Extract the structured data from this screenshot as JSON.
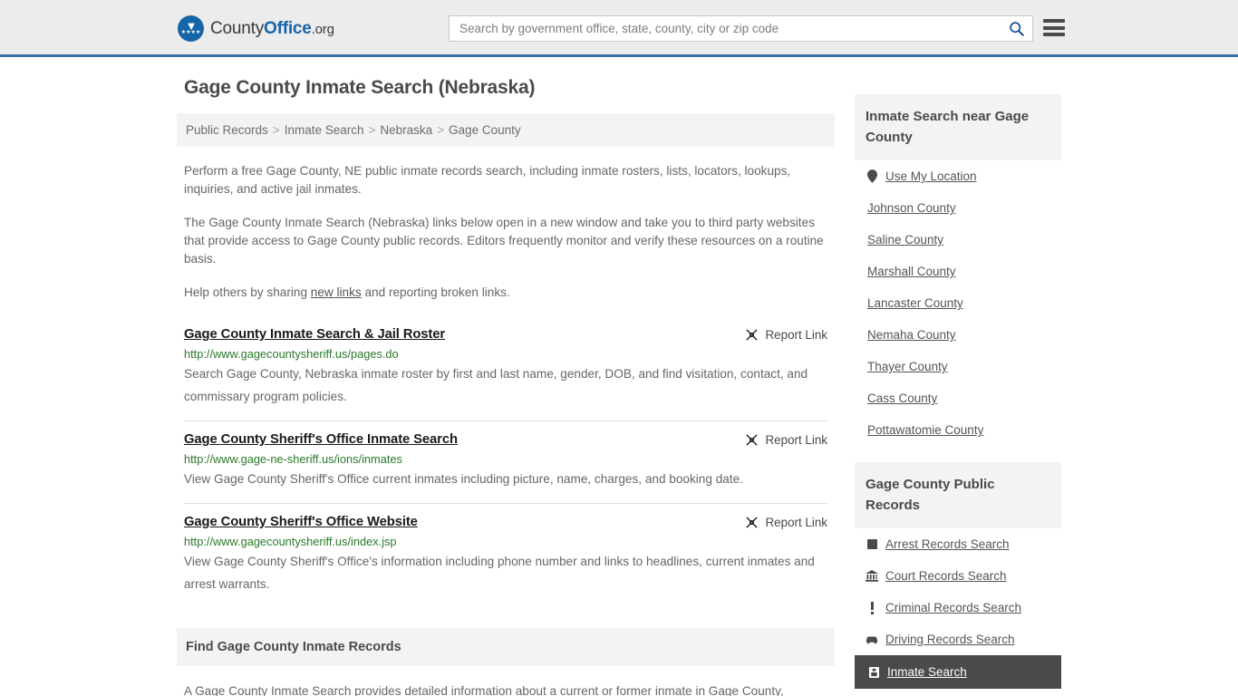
{
  "header": {
    "logo": {
      "part1": "County",
      "part2": "Office",
      "part3": ".org",
      "icon": "eagle-seal-icon",
      "eagle_glyph": "▼",
      "stars_glyph": "★★★★"
    },
    "search": {
      "placeholder": "Search by government office, state, county, city or zip code",
      "value": "",
      "icon": "search-icon"
    },
    "menu": {
      "icon": "hamburger-menu-icon",
      "label": "Menu"
    },
    "accent_color": "#3a6ea5",
    "background_color": "#ececec"
  },
  "page": {
    "title": "Gage County Inmate Search (Nebraska)"
  },
  "breadcrumb": {
    "items": [
      {
        "label": "Public Records"
      },
      {
        "label": "Inmate Search"
      },
      {
        "label": "Nebraska"
      },
      {
        "label": "Gage County"
      }
    ],
    "separator": ">"
  },
  "intro": {
    "p1": "Perform a free Gage County, NE public inmate records search, including inmate rosters, lists, locators, lookups, inquiries, and active jail inmates.",
    "p2": "The Gage County Inmate Search (Nebraska) links below open in a new window and take you to third party websites that provide access to Gage County public records. Editors frequently monitor and verify these resources on a routine basis.",
    "p3_before": "Help others by sharing ",
    "p3_link": "new links",
    "p3_after": " and reporting broken links."
  },
  "results": {
    "report_label": "Report Link",
    "report_icon": "broken-link-icon",
    "items": [
      {
        "title": "Gage County Inmate Search & Jail Roster",
        "url": "http://www.gagecountysheriff.us/pages.do",
        "description": "Search Gage County, Nebraska inmate roster by first and last name, gender, DOB, and find visitation, contact, and commissary program policies."
      },
      {
        "title": "Gage County Sheriff's Office Inmate Search",
        "url": "http://www.gage-ne-sheriff.us/ions/inmates",
        "description": "View Gage County Sheriff's Office current inmates including picture, name, charges, and booking date."
      },
      {
        "title": "Gage County Sheriff's Office Website",
        "url": "http://www.gagecountysheriff.us/index.jsp",
        "description": "View Gage County Sheriff's Office's information including phone number and links to headlines, current inmates and arrest warrants."
      }
    ]
  },
  "find_section": {
    "heading": "Find Gage County Inmate Records",
    "paragraph": "A Gage County Inmate Search provides detailed information about a current or former inmate in Gage County,"
  },
  "sidebar": {
    "near_panel": {
      "heading": "Inmate Search near Gage County",
      "items": [
        {
          "label": "Use My Location",
          "icon": "map-pin-icon",
          "glyph": "•"
        },
        {
          "label": "Johnson County",
          "icon": "",
          "glyph": ""
        },
        {
          "label": "Saline County",
          "icon": "",
          "glyph": ""
        },
        {
          "label": "Marshall County",
          "icon": "",
          "glyph": ""
        },
        {
          "label": "Lancaster County",
          "icon": "",
          "glyph": ""
        },
        {
          "label": "Nemaha County",
          "icon": "",
          "glyph": ""
        },
        {
          "label": "Thayer County",
          "icon": "",
          "glyph": ""
        },
        {
          "label": "Cass County",
          "icon": "",
          "glyph": ""
        },
        {
          "label": "Pottawatomie County",
          "icon": "",
          "glyph": ""
        }
      ]
    },
    "records_panel": {
      "heading": "Gage County Public Records",
      "items": [
        {
          "label": "Arrest Records Search",
          "icon": "square-icon",
          "glyph": "■",
          "active": false
        },
        {
          "label": "Court Records Search",
          "icon": "courthouse-icon",
          "glyph": "🏛",
          "active": false
        },
        {
          "label": "Criminal Records Search",
          "icon": "exclamation-icon",
          "glyph": "❗",
          "active": false
        },
        {
          "label": "Driving Records Search",
          "icon": "car-icon",
          "glyph": "🚘",
          "active": false
        },
        {
          "label": "Inmate Search",
          "icon": "id-card-icon",
          "glyph": "▣",
          "active": true
        }
      ]
    }
  }
}
